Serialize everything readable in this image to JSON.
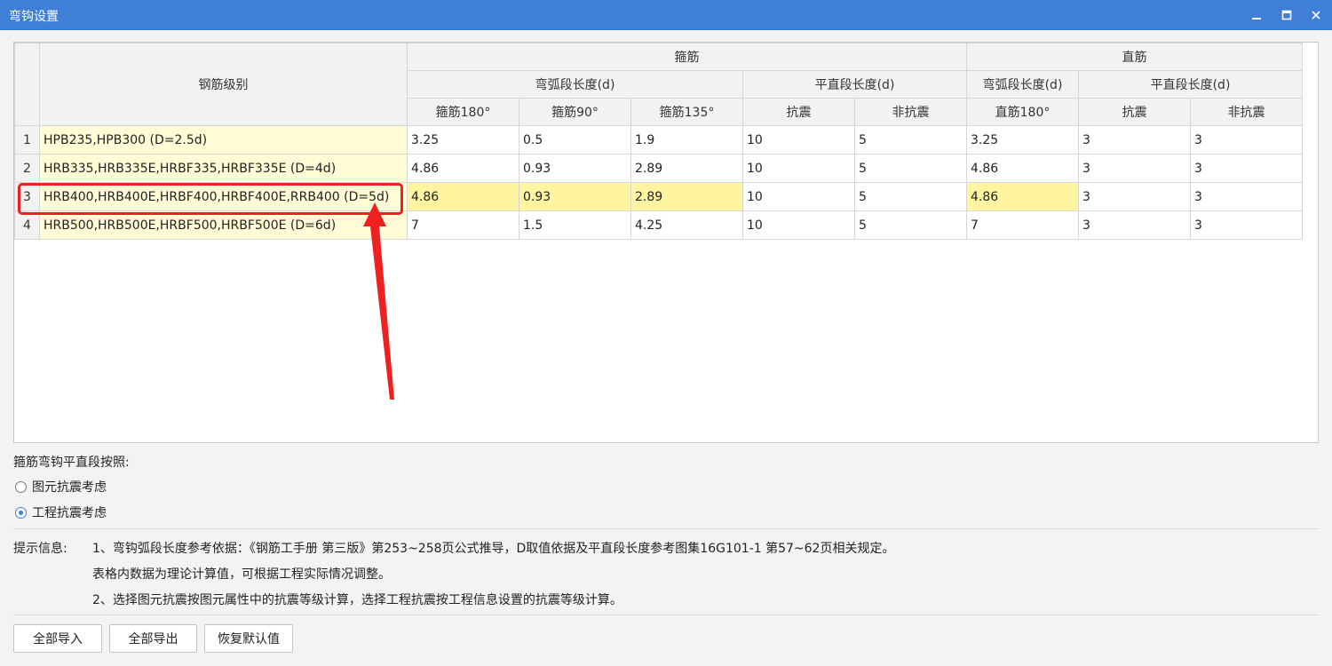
{
  "window": {
    "title": "弯钩设置"
  },
  "table": {
    "header": {
      "grade": "钢筋级别",
      "stirrup_group": "箍筋",
      "straight_group": "直筋",
      "arc_length": "弯弧段长度(d)",
      "flat_length": "平直段长度(d)",
      "straight_arc_length": "弯弧段长度(d)",
      "straight_flat_length": "平直段长度(d)",
      "cols": [
        "箍筋180°",
        "箍筋90°",
        "箍筋135°",
        "抗震",
        "非抗震",
        "直筋180°",
        "抗震",
        "非抗震"
      ]
    },
    "rows": [
      {
        "num": "1",
        "grade": "HPB235,HPB300 (D=2.5d)",
        "values": [
          "3.25",
          "0.5",
          "1.9",
          "10",
          "5",
          "3.25",
          "3",
          "3"
        ]
      },
      {
        "num": "2",
        "grade": "HRB335,HRB335E,HRBF335,HRBF335E (D=4d)",
        "values": [
          "4.86",
          "0.93",
          "2.89",
          "10",
          "5",
          "4.86",
          "3",
          "3"
        ]
      },
      {
        "num": "3",
        "grade": "HRB400,HRB400E,HRBF400,HRBF400E,RRB400 (D=5d)",
        "values": [
          "4.86",
          "0.93",
          "2.89",
          "10",
          "5",
          "4.86",
          "3",
          "3"
        ]
      },
      {
        "num": "4",
        "grade": "HRB500,HRB500E,HRBF500,HRBF500E (D=6d)",
        "values": [
          "7",
          "1.5",
          "4.25",
          "10",
          "5",
          "7",
          "3",
          "3"
        ]
      }
    ]
  },
  "options": {
    "label": "箍筋弯钩平直段按照:",
    "radio_element": "图元抗震考虑",
    "radio_project": "工程抗震考虑",
    "selected": "project"
  },
  "tips": {
    "label": "提示信息:",
    "line1": "1、弯钩弧段长度参考依据：《钢筋工手册 第三版》第253~258页公式推导，D取值依据及平直段长度参考图集16G101-1 第57~62页相关规定。",
    "line2": "表格内数据为理论计算值，可根据工程实际情况调整。",
    "line3": "2、选择图元抗震按图元属性中的抗震等级计算，选择工程抗震按工程信息设置的抗震等级计算。"
  },
  "buttons": {
    "import_all": "全部导入",
    "export_all": "全部导出",
    "restore_default": "恢复默认值"
  },
  "colors": {
    "titlebar": "#3f7fd6",
    "grade_cell": "#fffcd6",
    "highlight_cell": "#fff5a0",
    "annotation": "#ee2020"
  }
}
